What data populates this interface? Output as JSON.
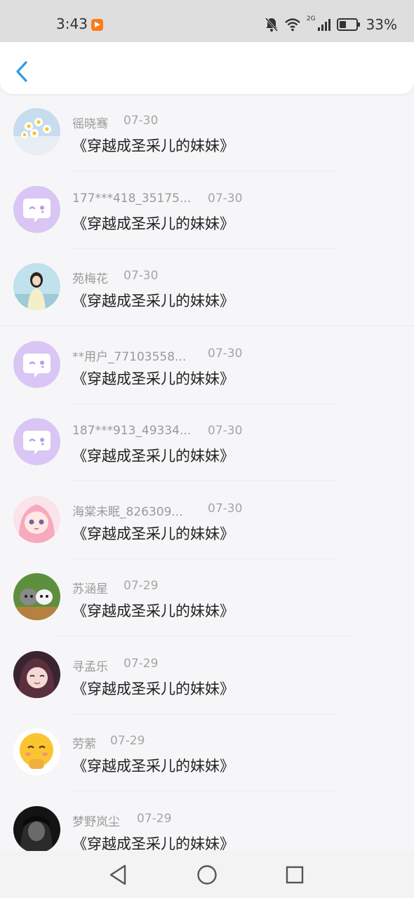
{
  "status_bar": {
    "time": "3:43",
    "battery": "33%",
    "network": "2G"
  },
  "header": {
    "back_icon": "chevron-left-icon",
    "accent": "#2c9be8"
  },
  "items": [
    {
      "name": "徭晓骞",
      "time": "07-30",
      "message": "《穿越成圣采儿的妹妹》",
      "avatar": "daisy-flowers"
    },
    {
      "name": "177***418_35175...",
      "time": "07-30",
      "message": "《穿越成圣采儿的妹妹》",
      "avatar": "default-chat-bubble"
    },
    {
      "name": "苑梅花",
      "time": "07-30",
      "message": "《穿越成圣采儿的妹妹》",
      "avatar": "girl-beach-photo"
    },
    {
      "name": "**用户_77103558...",
      "time": "07-30",
      "message": "《穿越成圣采儿的妹妹》",
      "avatar": "default-chat-bubble"
    },
    {
      "name": "187***913_49334...",
      "time": "07-30",
      "message": "《穿越成圣采儿的妹妹》",
      "avatar": "default-chat-bubble"
    },
    {
      "name": "海棠未眠_826309...",
      "time": "07-30",
      "message": "《穿越成圣采儿的妹妹》",
      "avatar": "pink-anime-girl"
    },
    {
      "name": "苏涵星",
      "time": "07-29",
      "message": "《穿越成圣采儿的妹妹》",
      "avatar": "kittens-basket"
    },
    {
      "name": "寻孟乐",
      "time": "07-29",
      "message": "《穿越成圣采儿的妹妹》",
      "avatar": "anime-girl-dark"
    },
    {
      "name": "劳萦",
      "time": "07-29",
      "message": "《穿越成圣采儿的妹妹》",
      "avatar": "emoji-face"
    },
    {
      "name": "梦野岚尘",
      "time": "07-29",
      "message": "《穿越成圣采儿的妹妹》",
      "avatar": "dark-character"
    }
  ],
  "nav": {
    "back": "triangle-back-icon",
    "home": "circle-home-icon",
    "recents": "square-recents-icon"
  }
}
